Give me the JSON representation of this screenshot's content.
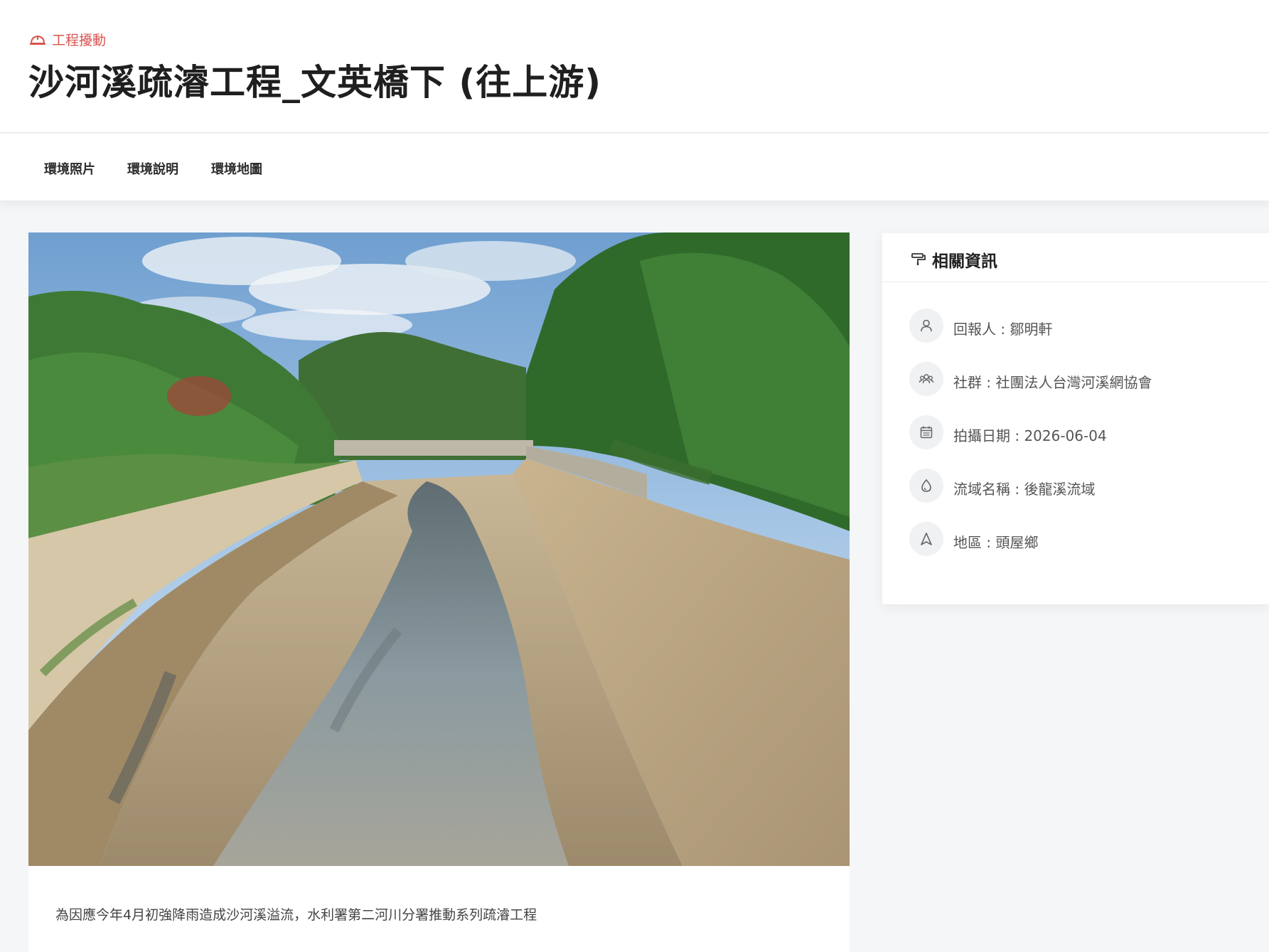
{
  "header": {
    "category_icon": "hard-hat-icon",
    "category": "工程擾動",
    "title": "沙河溪疏濬工程_文英橋下 (往上游)"
  },
  "tabs": [
    {
      "label": "環境照片"
    },
    {
      "label": "環境說明"
    },
    {
      "label": "環境地圖"
    }
  ],
  "photo": {
    "caption": "為因應今年4月初強降雨造成沙河溪溢流，水利署第二河川分署推動系列疏濬工程"
  },
  "info": {
    "title": "相關資訊",
    "title_icon": "paint-roller-icon",
    "rows": [
      {
        "icon": "user-icon",
        "text": "回報人 : 鄒明軒"
      },
      {
        "icon": "group-icon",
        "text": "社群 : 社團法人台灣河溪網協會"
      },
      {
        "icon": "calendar-icon",
        "text": "拍攝日期 : 2026-06-04"
      },
      {
        "icon": "water-drop-icon",
        "text": "流域名稱 : 後龍溪流域"
      },
      {
        "icon": "navigation-icon",
        "text": "地區 : 頭屋鄉"
      }
    ]
  },
  "colors": {
    "accent": "#d9534f",
    "background": "#f5f6f8",
    "card": "#ffffff",
    "title_text": "#1f1f1f",
    "muted_text": "#555555",
    "icon_bg": "#f0f1f3"
  }
}
